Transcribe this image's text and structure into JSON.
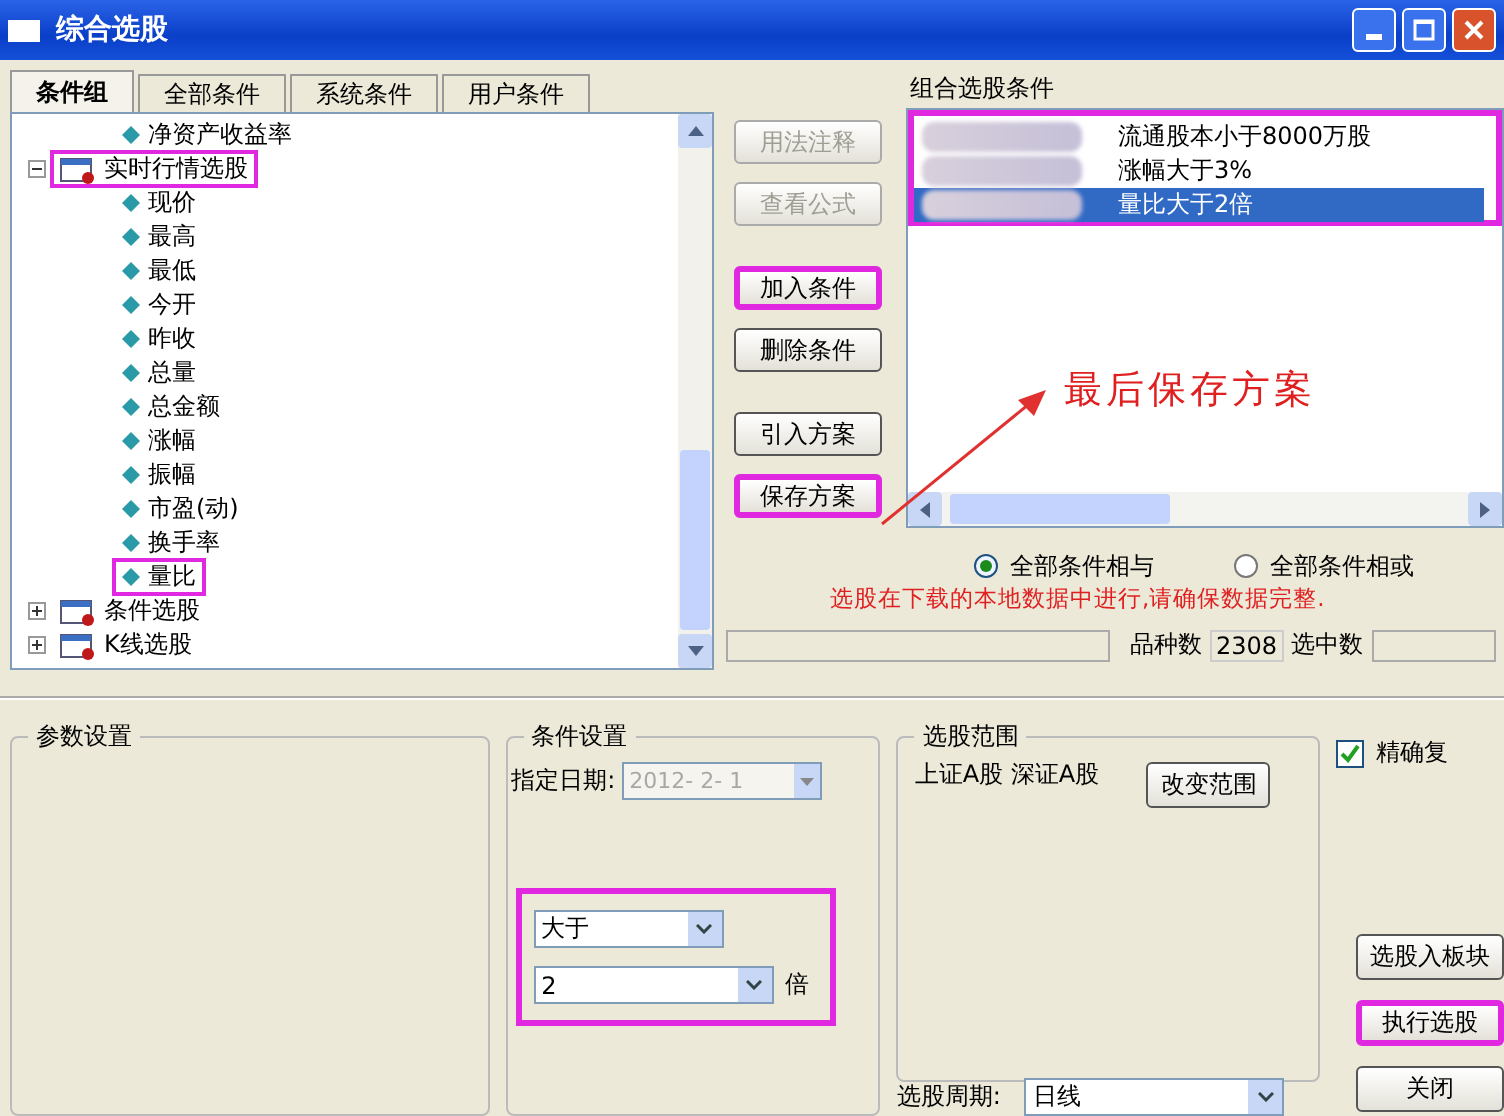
{
  "window": {
    "title": "综合选股"
  },
  "tabs": [
    {
      "label": "条件组",
      "selected": true
    },
    {
      "label": "全部条件",
      "selected": false
    },
    {
      "label": "系统条件",
      "selected": false
    },
    {
      "label": "用户条件",
      "selected": false
    }
  ],
  "tree": [
    {
      "label": "净资产收益率",
      "kind": "leaf",
      "highlighted": false
    },
    {
      "label": "实时行情选股",
      "kind": "group",
      "expanded": true,
      "highlighted": true,
      "children": [
        {
          "label": "现价",
          "highlighted": false
        },
        {
          "label": "最高",
          "highlighted": false
        },
        {
          "label": "最低",
          "highlighted": false
        },
        {
          "label": "今开",
          "highlighted": false
        },
        {
          "label": "昨收",
          "highlighted": false
        },
        {
          "label": "总量",
          "highlighted": false
        },
        {
          "label": "总金额",
          "highlighted": false
        },
        {
          "label": "涨幅",
          "highlighted": false
        },
        {
          "label": "振幅",
          "highlighted": false
        },
        {
          "label": "市盈(动)",
          "highlighted": false
        },
        {
          "label": "换手率",
          "highlighted": false
        },
        {
          "label": "量比",
          "highlighted": true
        }
      ]
    },
    {
      "label": "条件选股",
      "kind": "group",
      "expanded": false,
      "highlighted": false
    },
    {
      "label": "K线选股",
      "kind": "group",
      "expanded": false,
      "highlighted": false
    }
  ],
  "side_buttons": [
    {
      "label": "用法注释",
      "disabled": true,
      "highlighted": false
    },
    {
      "label": "查看公式",
      "disabled": true,
      "highlighted": false
    },
    {
      "label": "加入条件",
      "disabled": false,
      "highlighted": true
    },
    {
      "label": "删除条件",
      "disabled": false,
      "highlighted": false
    },
    {
      "label": "引入方案",
      "disabled": false,
      "highlighted": false
    },
    {
      "label": "保存方案",
      "disabled": false,
      "highlighted": true
    }
  ],
  "conditions": {
    "title": "组合选股条件",
    "highlighted": true,
    "items": [
      {
        "text": "流通股本小于8000万股",
        "selected": false
      },
      {
        "text": "涨幅大于3%",
        "selected": false
      },
      {
        "text": "量比大于2倍",
        "selected": true
      }
    ]
  },
  "annotation": {
    "text": "最后保存方案"
  },
  "logic": [
    {
      "label": "全部条件相与",
      "selected": true
    },
    {
      "label": "全部条件相或",
      "selected": false
    }
  ],
  "note": "选股在下载的本地数据中进行,请确保数据完整.",
  "status": {
    "count_label": "品种数",
    "count": "2308",
    "selected_label": "选中数"
  },
  "params": {
    "title": "参数设置"
  },
  "condition_settings": {
    "title": "条件设置",
    "date_label": "指定日期:",
    "date": "2012- 2- 1",
    "date_disabled": true,
    "highlighted": true,
    "operator": "大于",
    "value": "2",
    "unit": "倍"
  },
  "range": {
    "title": "选股范围",
    "text": "上证A股 深证A股",
    "button": "改变范围",
    "period_label": "选股周期:",
    "period": "日线"
  },
  "right": {
    "checkbox": {
      "label": "精确复",
      "checked": true
    },
    "buttons": [
      {
        "label": "选股入板块",
        "highlighted": false
      },
      {
        "label": "执行选股",
        "highlighted": true
      },
      {
        "label": "关闭",
        "highlighted": false
      }
    ]
  }
}
